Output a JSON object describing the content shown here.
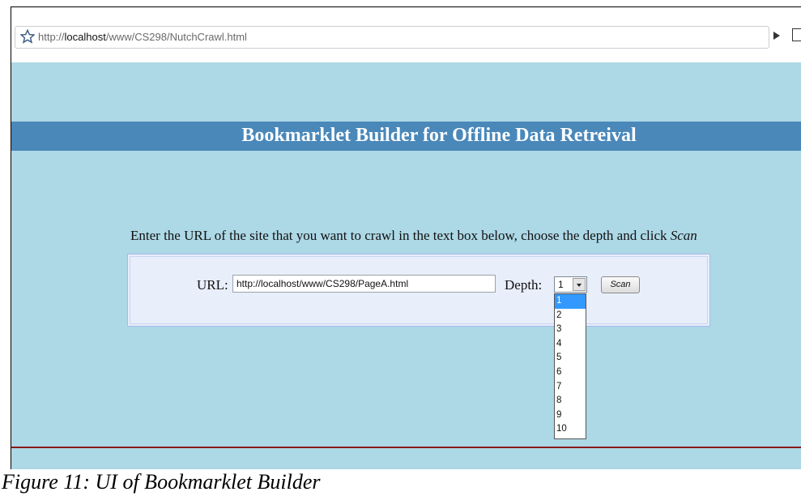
{
  "browser": {
    "url_prefix": "http://",
    "url_host": "localhost",
    "url_path": "/www/CS298/NutchCrawl.html"
  },
  "page": {
    "title": "Bookmarklet Builder for Offline Data Retreival",
    "instruction": "Enter the URL of the site that you want to crawl in the text box below, choose the depth and click ",
    "instruction_emphasis": "Scan",
    "url_label": "URL:",
    "url_value": "http://localhost/www/CS298/PageA.html",
    "depth_label": "Depth:",
    "depth_value": "1",
    "scan_label": "Scan",
    "depth_options": [
      "1",
      "2",
      "3",
      "4",
      "5",
      "6",
      "7",
      "8",
      "9",
      "10"
    ],
    "selected_option_index": 0
  },
  "caption": "Figure 11: UI of Bookmarklet Builder",
  "colors": {
    "page_bg": "#add8e6",
    "banner_bg": "#4a88ba",
    "form_bg": "#e8eefa",
    "rule": "#8b1a1a",
    "selected_option": "#3399ff"
  }
}
